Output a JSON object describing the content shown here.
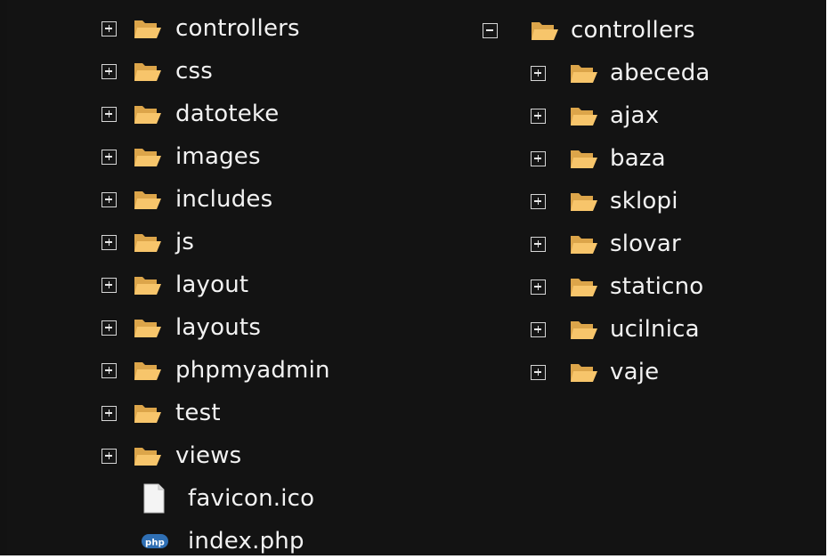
{
  "left_tree": {
    "items": [
      {
        "label": "controllers",
        "kind": "folder",
        "state": "collapsed"
      },
      {
        "label": "css",
        "kind": "folder",
        "state": "collapsed"
      },
      {
        "label": "datoteke",
        "kind": "folder",
        "state": "collapsed"
      },
      {
        "label": "images",
        "kind": "folder",
        "state": "collapsed"
      },
      {
        "label": "includes",
        "kind": "folder",
        "state": "collapsed"
      },
      {
        "label": "js",
        "kind": "folder",
        "state": "collapsed"
      },
      {
        "label": "layout",
        "kind": "folder",
        "state": "collapsed"
      },
      {
        "label": "layouts",
        "kind": "folder",
        "state": "collapsed"
      },
      {
        "label": "phpmyadmin",
        "kind": "folder",
        "state": "collapsed"
      },
      {
        "label": "test",
        "kind": "folder",
        "state": "collapsed"
      },
      {
        "label": "views",
        "kind": "folder",
        "state": "collapsed"
      },
      {
        "label": "favicon.ico",
        "kind": "file",
        "icon": "file-icon"
      },
      {
        "label": "index.php",
        "kind": "file",
        "icon": "php-file-icon"
      }
    ]
  },
  "right_tree": {
    "root": {
      "label": "controllers",
      "kind": "folder",
      "state": "expanded"
    },
    "children": [
      {
        "label": "abeceda",
        "kind": "folder",
        "state": "collapsed"
      },
      {
        "label": "ajax",
        "kind": "folder",
        "state": "collapsed"
      },
      {
        "label": "baza",
        "kind": "folder",
        "state": "collapsed"
      },
      {
        "label": "sklopi",
        "kind": "folder",
        "state": "collapsed"
      },
      {
        "label": "slovar",
        "kind": "folder",
        "state": "collapsed"
      },
      {
        "label": "staticno",
        "kind": "folder",
        "state": "collapsed"
      },
      {
        "label": "ucilnica",
        "kind": "folder",
        "state": "collapsed"
      },
      {
        "label": "vaje",
        "kind": "folder",
        "state": "collapsed"
      }
    ]
  },
  "php_badge": "php",
  "colors": {
    "background": "#131313",
    "text": "#f2f2f2",
    "folder_front": "#f6c56c",
    "folder_back": "#e0a94a",
    "php_badge": "#2f6fb4"
  }
}
